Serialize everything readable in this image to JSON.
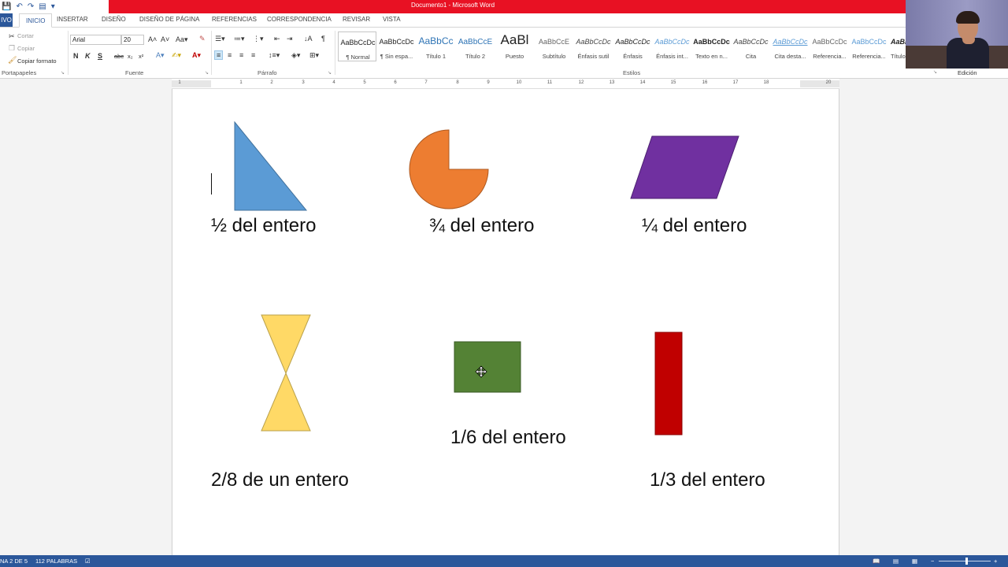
{
  "window": {
    "title": "Documento1 - Microsoft Word"
  },
  "quick_access": {
    "save_icon": "save-icon",
    "undo_icon": "undo-icon",
    "redo_icon": "redo-icon"
  },
  "tabs": [
    {
      "label": "IVO",
      "name": "tab-file"
    },
    {
      "label": "INICIO",
      "name": "tab-inicio"
    },
    {
      "label": "INSERTAR",
      "name": "tab-insertar"
    },
    {
      "label": "DISEÑO",
      "name": "tab-diseno"
    },
    {
      "label": "DISEÑO DE PÁGINA",
      "name": "tab-diseno-pagina"
    },
    {
      "label": "REFERENCIAS",
      "name": "tab-referencias"
    },
    {
      "label": "CORRESPONDENCIA",
      "name": "tab-correspondencia"
    },
    {
      "label": "REVISAR",
      "name": "tab-revisar"
    },
    {
      "label": "VISTA",
      "name": "tab-vista"
    }
  ],
  "clipboard": {
    "cut": "Cortar",
    "copy": "Copiar",
    "format_painter": "Copiar formato",
    "group": "Portapapeles"
  },
  "font": {
    "family": "Arial",
    "size": "20",
    "bold": "N",
    "italic": "K",
    "underline": "S",
    "strike": "abc",
    "subscript": "x₂",
    "superscript": "x²",
    "group": "Fuente"
  },
  "paragraph": {
    "group": "Párrafo"
  },
  "styles": {
    "group": "Estilos",
    "items": [
      {
        "sample": "AaBbCcDc",
        "label": "¶ Normal"
      },
      {
        "sample": "AaBbCcDc",
        "label": "¶ Sin espa..."
      },
      {
        "sample": "AaBbCc",
        "label": "Título 1"
      },
      {
        "sample": "AaBbCcE",
        "label": "Título 2"
      },
      {
        "sample": "AaBl",
        "label": "Puesto"
      },
      {
        "sample": "AaBbCcE",
        "label": "Subtítulo"
      },
      {
        "sample": "AaBbCcDc",
        "label": "Énfasis sutil"
      },
      {
        "sample": "AaBbCcDc",
        "label": "Énfasis"
      },
      {
        "sample": "AaBbCcDc",
        "label": "Énfasis int..."
      },
      {
        "sample": "AaBbCcDc",
        "label": "Texto en n..."
      },
      {
        "sample": "AaBbCcDc",
        "label": "Cita"
      },
      {
        "sample": "AaBbCcDc",
        "label": "Cita desta..."
      },
      {
        "sample": "AaBbCcDc",
        "label": "Referencia..."
      },
      {
        "sample": "AaBbCcDc",
        "label": "Referencia..."
      },
      {
        "sample": "AaBb",
        "label": "Título"
      }
    ]
  },
  "editing": {
    "group": "Edición"
  },
  "ruler": {
    "numbers": [
      "1",
      "1",
      "2",
      "3",
      "4",
      "5",
      "6",
      "7",
      "8",
      "9",
      "10",
      "11",
      "12",
      "13",
      "14",
      "15",
      "16",
      "17",
      "18",
      "20"
    ]
  },
  "document": {
    "fractions": [
      {
        "label": "½ del entero",
        "color": "#5b9bd5"
      },
      {
        "label": "¾ del entero",
        "color": "#ed7d31"
      },
      {
        "label": "¼ del entero",
        "color": "#7030a0"
      },
      {
        "label": "2/8 de un entero",
        "color": "#ffd966"
      },
      {
        "label": "1/6 del entero",
        "color": "#548235"
      },
      {
        "label": "1/3 del entero",
        "color": "#c00000"
      }
    ]
  },
  "status": {
    "page": "NA 2 DE 5",
    "words": "112 PALABRAS"
  },
  "colors": {
    "accent": "#2b579a",
    "titlebar": "#e81123"
  }
}
